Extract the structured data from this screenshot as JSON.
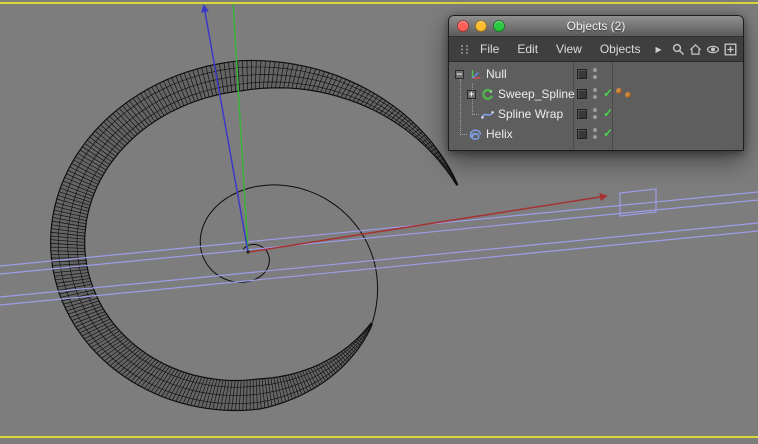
{
  "viewport": {
    "background": "#7d7d7d",
    "border_color": "#d9d93c",
    "wire_color": "#0d0d0d",
    "wrap_color": "#9d9de8",
    "axes": {
      "x_color": "#a63232",
      "y_color": "#3bb23b",
      "z_color": "#3a3ac6"
    },
    "origin_color": "#222222"
  },
  "panel": {
    "title": "Objects (2)",
    "traffic_lights": {
      "close": "#ff5f57",
      "minimize": "#febc2e",
      "zoom": "#28c840"
    },
    "menu_items": [
      "File",
      "Edit",
      "View",
      "Objects"
    ],
    "overflow_arrow": "▶",
    "check_glyph": "✓",
    "icons": [
      "grip-icon",
      "search-icon",
      "home-icon",
      "eye-icon",
      "add-object-icon"
    ],
    "objects": [
      {
        "name": "Null",
        "expander": "−",
        "type": "null",
        "enabled": null
      },
      {
        "name": "Sweep_Spline",
        "expander": "+",
        "type": "sweep",
        "enabled": true,
        "tags": 2
      },
      {
        "name": "Spline Wrap",
        "expander": null,
        "type": "spline-wrap",
        "enabled": true
      },
      {
        "name": "Helix",
        "expander": null,
        "type": "helix",
        "enabled": true
      }
    ]
  }
}
